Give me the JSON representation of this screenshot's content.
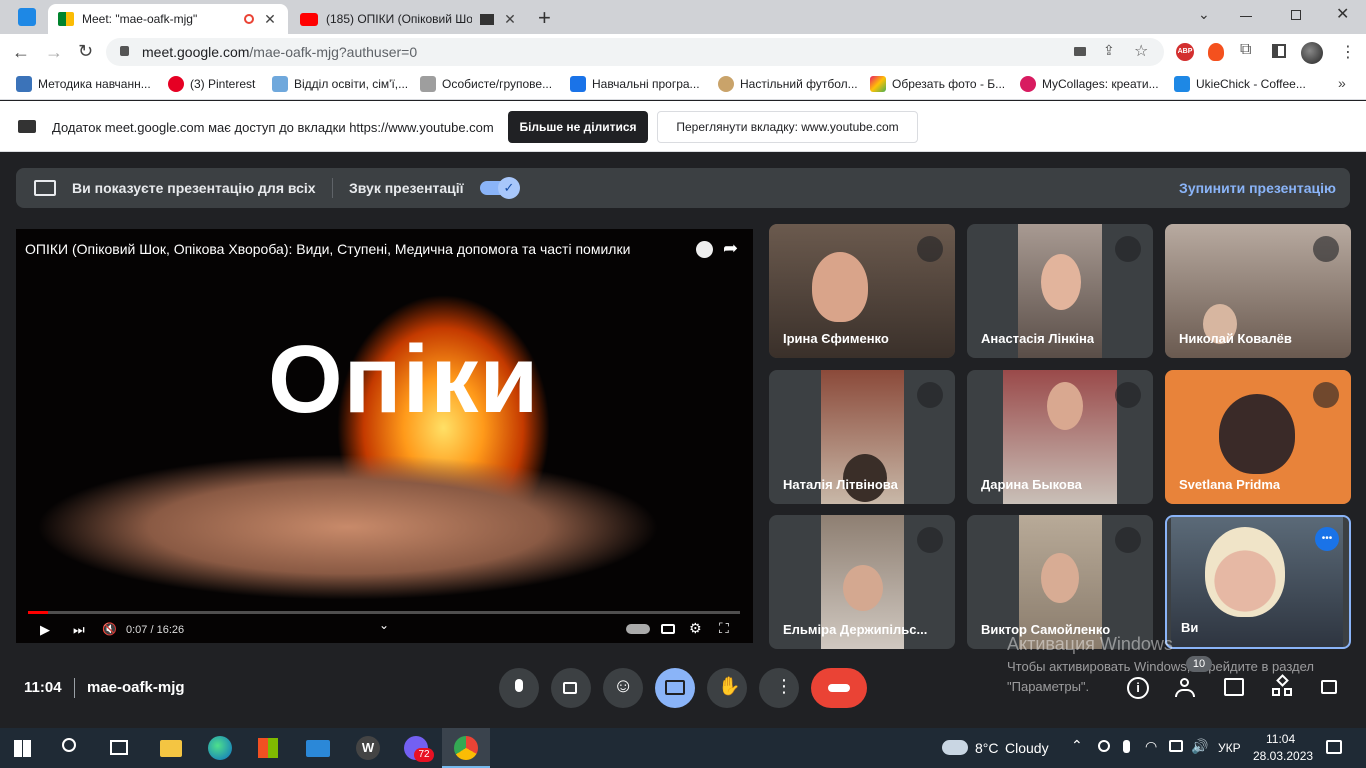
{
  "tabs": [
    {
      "title": "Meet: \"mae-oafk-mjg\"",
      "icon": "google-meet-icon",
      "active": true
    },
    {
      "title": "(185) ОПІКИ (Опіковий Шок",
      "icon": "youtube-icon",
      "active": false
    }
  ],
  "url": {
    "host": "meet.google.com",
    "path": "/mae-oafk-mjg?authuser=0"
  },
  "bookmarks": [
    {
      "label": "Методика навчанн...",
      "color": "#3b73b9"
    },
    {
      "label": "(3) Pinterest",
      "color": "#e60023"
    },
    {
      "label": "Відділ освіти, сім'ї,...",
      "color": "#6fa8dc"
    },
    {
      "label": "Особисте/групове...",
      "color": "#9e9e9e"
    },
    {
      "label": "Навчальні програ...",
      "color": "#1a73e8"
    },
    {
      "label": "Настільний футбол...",
      "color": "#c9a36a"
    },
    {
      "label": "Обрезать фото - Б...",
      "color": "#e91e63"
    },
    {
      "label": "MyCollages: креати...",
      "color": "#d81b60"
    },
    {
      "label": "UkieChick - Coffee...",
      "color": "#1e88e5"
    }
  ],
  "extensions": {
    "abp": "ABP"
  },
  "infobar": {
    "message": "Додаток meet.google.com має доступ до вкладки https://www.youtube.com",
    "stop_sharing": "Більше не ділитися",
    "view_tab": "Переглянути вкладку: www.youtube.com"
  },
  "presentation_bar": {
    "presenting_text": "Ви показуєте презентацію для всіх",
    "audio_label": "Звук презентації",
    "audio_enabled": true,
    "stop_label": "Зупинити презентацію"
  },
  "video": {
    "title": "ОПІКИ (Опіковий Шок, Опікова Хвороба): Види, Ступені, Медична допомога та часті помилки",
    "overlay_text": "Опіки",
    "time": "0:07 / 16:26",
    "progress": 0.007
  },
  "participants": [
    {
      "name": "Ірина Єфименко",
      "muted": true,
      "bg": "#6b5a4e"
    },
    {
      "name": "Анастасія Лінкіна",
      "muted": true,
      "bg": "#7d6e68"
    },
    {
      "name": "Николай Ковалёв",
      "muted": true,
      "bg": "#8a7a70"
    },
    {
      "name": "Наталія Літвінова",
      "muted": true,
      "bg": "#8b4a3a"
    },
    {
      "name": "Дарина Быкова",
      "muted": true,
      "bg": "#9a4a4a"
    },
    {
      "name": "Svetlana Pridma",
      "muted": true,
      "bg": "#e8833a"
    },
    {
      "name": "Ельміра Держипільс...",
      "muted": true,
      "bg": "#8e7f72"
    },
    {
      "name": "Виктор Самойленко",
      "muted": true,
      "bg": "#b8aa98"
    },
    {
      "name": "Ви",
      "muted": false,
      "bg": "#5b6a78",
      "speaking": true
    }
  ],
  "meeting": {
    "time": "11:04",
    "code": "mae-oafk-mjg",
    "participant_count": "10"
  },
  "activation": {
    "title": "Активация Windows",
    "text": "Чтобы активировать Windows, перейдите в раздел \"Параметры\"."
  },
  "taskbar": {
    "weather_temp": "8°C",
    "weather_text": "Cloudy",
    "lang": "УКР",
    "clock_time": "11:04",
    "clock_date": "28.03.2023",
    "viber_badge": "72"
  }
}
